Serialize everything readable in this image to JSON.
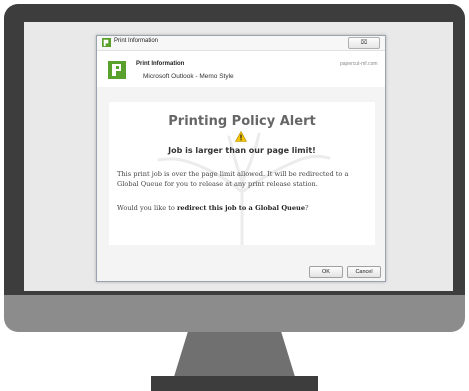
{
  "dialog": {
    "window_title": "Print Information",
    "close_symbol": "⌧",
    "header_title": "Print Information",
    "header_subtitle": "Microsoft Outlook - Memo Style",
    "header_link": "papercut-mf.com"
  },
  "alert": {
    "title": "Printing Policy Alert",
    "subtitle": "Job is larger than our page limit!",
    "body": "This print job is over the page limit allowed. It will be redirected to a Global Queue for you to release at any print release station.",
    "question_prefix": "Would you like to ",
    "question_bold": "redirect this job to a Global Queue",
    "question_suffix": "?"
  },
  "buttons": {
    "ok": "OK",
    "cancel": "Cancel"
  },
  "colors": {
    "bezel": "#3d3d3d",
    "chin": "#8c8c8c",
    "papercut_green": "#5aa02c",
    "warning_yellow": "#f5c400"
  },
  "icons": [
    "papercut-logo-icon",
    "warning-icon",
    "close-icon"
  ]
}
